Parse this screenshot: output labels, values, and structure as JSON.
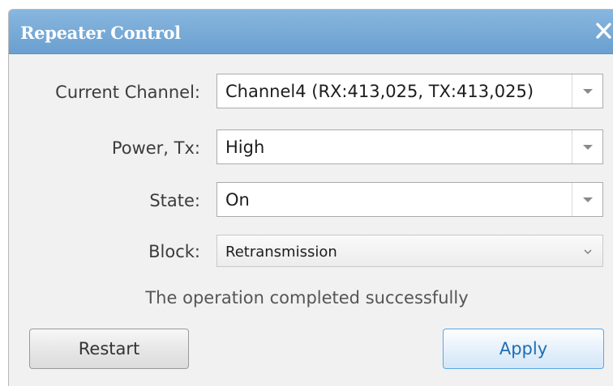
{
  "window": {
    "title": "Repeater Control",
    "close_icon": "close-icon"
  },
  "form": {
    "rows": [
      {
        "label": "Current Channel:",
        "value": "Channel4 (RX:413,025, TX:413,025)"
      },
      {
        "label": "Power, Tx:",
        "value": "High"
      },
      {
        "label": "State:",
        "value": "On"
      },
      {
        "label": "Block:",
        "value": "Retransmission"
      }
    ]
  },
  "status": {
    "message": "The operation completed successfully"
  },
  "buttons": {
    "restart": "Restart",
    "apply": "Apply"
  },
  "colors": {
    "titlebar": "#6a9fd0",
    "apply_accent": "#1e6db4"
  }
}
